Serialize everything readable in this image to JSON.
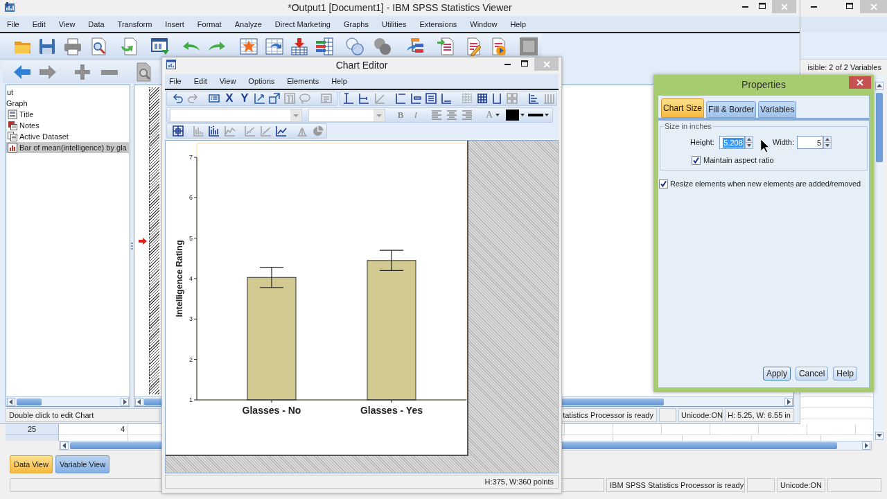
{
  "data_editor": {
    "visible_variables": "isible: 2 of 2 Variables",
    "rows": [
      {
        "number": "25",
        "cells": [
          "4"
        ]
      }
    ],
    "tabs": [
      {
        "label": "Data View",
        "selected": true
      },
      {
        "label": "Variable View",
        "selected": false
      }
    ],
    "status_bar": [
      "IBM SPSS Statistics Processor is ready",
      "Unicode:ON"
    ]
  },
  "viewer": {
    "title": "*Output1 [Document1] - IBM SPSS Statistics Viewer",
    "menu": [
      "File",
      "Edit",
      "View",
      "Data",
      "Transform",
      "Insert",
      "Format",
      "Analyze",
      "Direct Marketing",
      "Graphs",
      "Utilities",
      "Extensions",
      "Window",
      "Help"
    ],
    "outline": [
      {
        "label": "ut",
        "selected": false,
        "children": [
          {
            "label": "Graph",
            "selected": false,
            "children": [
              {
                "label": "Title",
                "kind": "title",
                "selected": false
              },
              {
                "label": "Notes",
                "kind": "notes",
                "selected": false
              },
              {
                "label": "Active Dataset",
                "kind": "dataset",
                "selected": false
              },
              {
                "label": "Bar of mean(intelligence) by gla",
                "kind": "chart",
                "selected": true
              }
            ]
          }
        ]
      }
    ],
    "status_bar": {
      "hint": "Double click to edit Chart",
      "processor": "tatistics Processor is ready",
      "unicode": "Unicode:ON",
      "size": "H: 5.25, W: 6.55 in"
    }
  },
  "chart_editor": {
    "title": "Chart Editor",
    "menu": [
      "File",
      "Edit",
      "View",
      "Options",
      "Elements",
      "Help"
    ],
    "axis_buttons": [
      "X",
      "Y"
    ],
    "style_buttons": [
      "B",
      "I"
    ],
    "text_color_button": "A",
    "chart_data": {
      "type": "bar",
      "ylabel": "Intelligence Rating",
      "categories": [
        "Glasses - No",
        "Glasses - Yes"
      ],
      "values": [
        4.03,
        4.45
      ],
      "ylim": [
        1,
        7
      ],
      "yticks": [
        1,
        2,
        3,
        4,
        5,
        6,
        7
      ]
    },
    "status": "H:375, W:360 points"
  },
  "properties": {
    "title": "Properties",
    "tabs": [
      {
        "label": "Chart Size",
        "selected": true
      },
      {
        "label": "Fill & Border",
        "selected": false
      },
      {
        "label": "Variables",
        "selected": false
      }
    ],
    "group_label": "Size in inches",
    "height": {
      "label": "Height:",
      "value": "5.208",
      "text_selected": true
    },
    "width": {
      "label": "Width:",
      "value": "5",
      "text_selected": false
    },
    "maintain_aspect_ratio": {
      "label": "Maintain aspect ratio",
      "checked": true
    },
    "resize_elements": {
      "label": "Resize elements when new elements are added/removed",
      "checked": true
    },
    "buttons": [
      "Apply",
      "Cancel",
      "Help"
    ]
  }
}
